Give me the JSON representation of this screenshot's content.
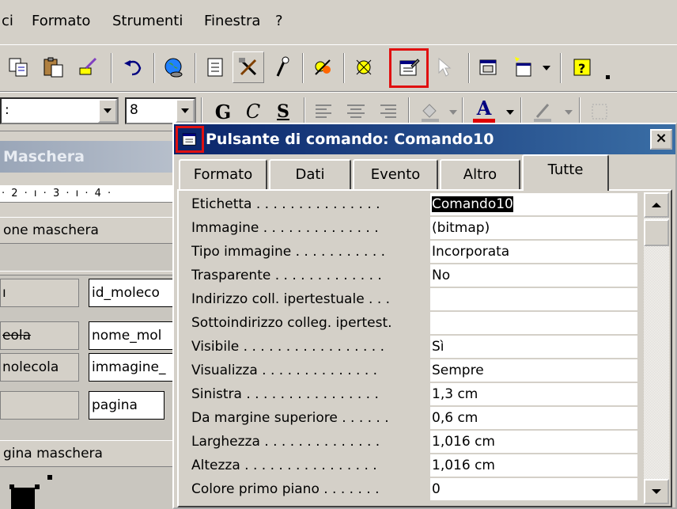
{
  "menu": {
    "items": [
      {
        "label": "ci"
      },
      {
        "label": "Formato"
      },
      {
        "label": "Strumenti"
      },
      {
        "label": "Finestra"
      },
      {
        "label": "?"
      }
    ]
  },
  "formatting_toolbar": {
    "font_size": "8",
    "bold_label": "G",
    "italic_label": "C",
    "underline_label": "S",
    "font_color_label": "A"
  },
  "design_view": {
    "title": "Maschera",
    "ruler": "· 2 · ı · 3 · ı · 4 ·",
    "section_header": "one maschera",
    "section_footer": "gina maschera",
    "controls": [
      {
        "label": "ı",
        "field": "id_moleco"
      },
      {
        "label": "eola",
        "field": "nome_mol"
      },
      {
        "label": "nolecola",
        "field": "immagine_"
      },
      {
        "label": "",
        "field": "pagina"
      }
    ]
  },
  "property_sheet": {
    "title": "Pulsante di comando: Comando10",
    "close_label": "×",
    "tabs": [
      {
        "label": "Formato"
      },
      {
        "label": "Dati"
      },
      {
        "label": "Evento"
      },
      {
        "label": "Altro"
      },
      {
        "label": "Tutte"
      }
    ],
    "active_tab": "Tutte",
    "properties": [
      {
        "name": "Etichetta . . . . . . . . . . . . . . .",
        "value": "Comando10"
      },
      {
        "name": "Immagine . . . . . . . . . . . . . .",
        "value": "(bitmap)"
      },
      {
        "name": "Tipo immagine . . . . . . . . . . .",
        "value": "Incorporata"
      },
      {
        "name": "Trasparente . . . . . . . . . . . . .",
        "value": "No"
      },
      {
        "name": "Indirizzo coll. ipertestuale . . .",
        "value": ""
      },
      {
        "name": "Sottoindirizzo colleg. ipertest.",
        "value": ""
      },
      {
        "name": "Visibile . . . . . . . . . . . . . . . . .",
        "value": "Sì"
      },
      {
        "name": "Visualizza . . . . . . . . . . . . . .",
        "value": "Sempre"
      },
      {
        "name": "Sinistra . . . . . . . . . . . . . . . .",
        "value": "1,3 cm"
      },
      {
        "name": "Da margine superiore . . . . . .",
        "value": "0,6 cm"
      },
      {
        "name": "Larghezza . . . . . . . . . . . . . .",
        "value": "1,016 cm"
      },
      {
        "name": "Altezza . . . . . . . . . . . . . . . .",
        "value": "1,016 cm"
      },
      {
        "name": "Colore primo piano . . . . . . .",
        "value": "0"
      }
    ]
  },
  "colors": {
    "highlight": "#e01010",
    "title_bar": "#0a246a",
    "face": "#d4d0c8"
  }
}
